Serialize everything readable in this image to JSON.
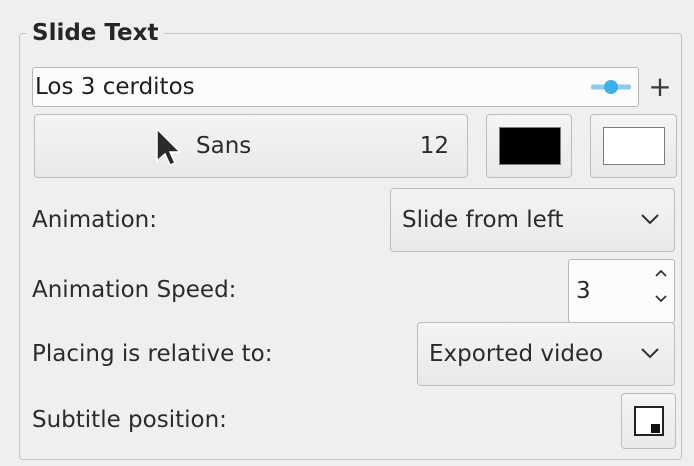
{
  "group": {
    "title": "Slide Text"
  },
  "text_entry": {
    "value": "Los 3 cerditos"
  },
  "add_button": {
    "label": "+"
  },
  "font": {
    "name": "Sans",
    "size": "12"
  },
  "colors": {
    "text_color": "#000000",
    "background_color": "#ffffff"
  },
  "animation": {
    "label": "Animation:",
    "value": "Slide from left"
  },
  "speed": {
    "label": "Animation Speed:",
    "value": "3"
  },
  "placing": {
    "label": "Placing is relative to:",
    "value": "Exported video"
  },
  "subtitle_position": {
    "label": "Subtitle position:"
  },
  "accent_color": "#3daee9"
}
